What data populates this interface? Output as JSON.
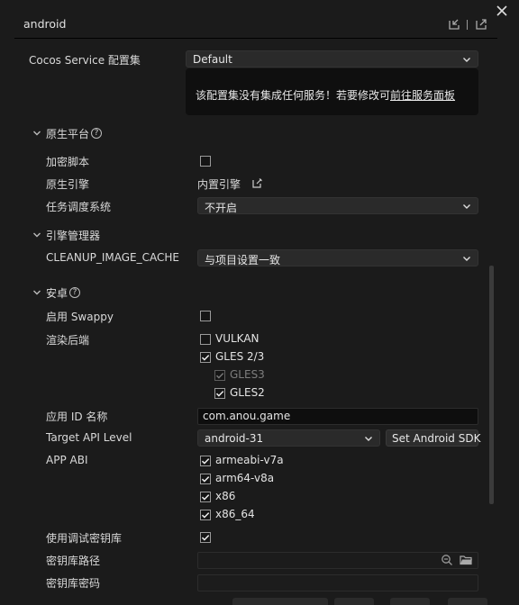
{
  "window": {
    "title": "android"
  },
  "header_icons": {
    "export": "export-icon",
    "open": "open-external-icon",
    "close": "close-icon"
  },
  "cocos_service": {
    "label": "Cocos Service 配置集",
    "value": "Default",
    "message_prefix": "该配置集没有集成任何服务！若要修改可",
    "message_link": "前往服务面板"
  },
  "native_platform": {
    "section_title": "原生平台",
    "encrypt_label": "加密脚本",
    "encrypt_checked": false,
    "engine_label": "原生引擎",
    "engine_value": "内置引擎",
    "scheduler_label": "任务调度系统",
    "scheduler_value": "不开启"
  },
  "engine_manager": {
    "section_title": "引擎管理器",
    "cleanup_label": "CLEANUP_IMAGE_CACHE",
    "cleanup_value": "与项目设置一致"
  },
  "android": {
    "section_title": "安卓",
    "swappy_label": "启用 Swappy",
    "swappy_checked": false,
    "render_label": "渲染后端",
    "render_options": [
      {
        "label": "VULKAN",
        "checked": false,
        "disabled": false
      },
      {
        "label": "GLES 2/3",
        "checked": true,
        "disabled": false
      },
      {
        "label": "GLES3",
        "checked": true,
        "disabled": true
      },
      {
        "label": "GLES2",
        "checked": true,
        "disabled": false
      }
    ],
    "app_id_label": "应用 ID 名称",
    "app_id_value": "com.anou.game",
    "api_label": "Target API Level",
    "api_value": "android-31",
    "sdk_button": "Set Android SDK",
    "abi_label": "APP ABI",
    "abi_options": [
      {
        "label": "armeabi-v7a",
        "checked": true
      },
      {
        "label": "arm64-v8a",
        "checked": true
      },
      {
        "label": "x86",
        "checked": true
      },
      {
        "label": "x86_64",
        "checked": true
      }
    ],
    "debug_keystore_label": "使用调试密钥库",
    "debug_keystore_checked": true,
    "keystore_path_label": "密钥库路径",
    "keystore_path_value": "",
    "keystore_pwd_label": "密钥库密码",
    "keystore_pwd_value": ""
  }
}
